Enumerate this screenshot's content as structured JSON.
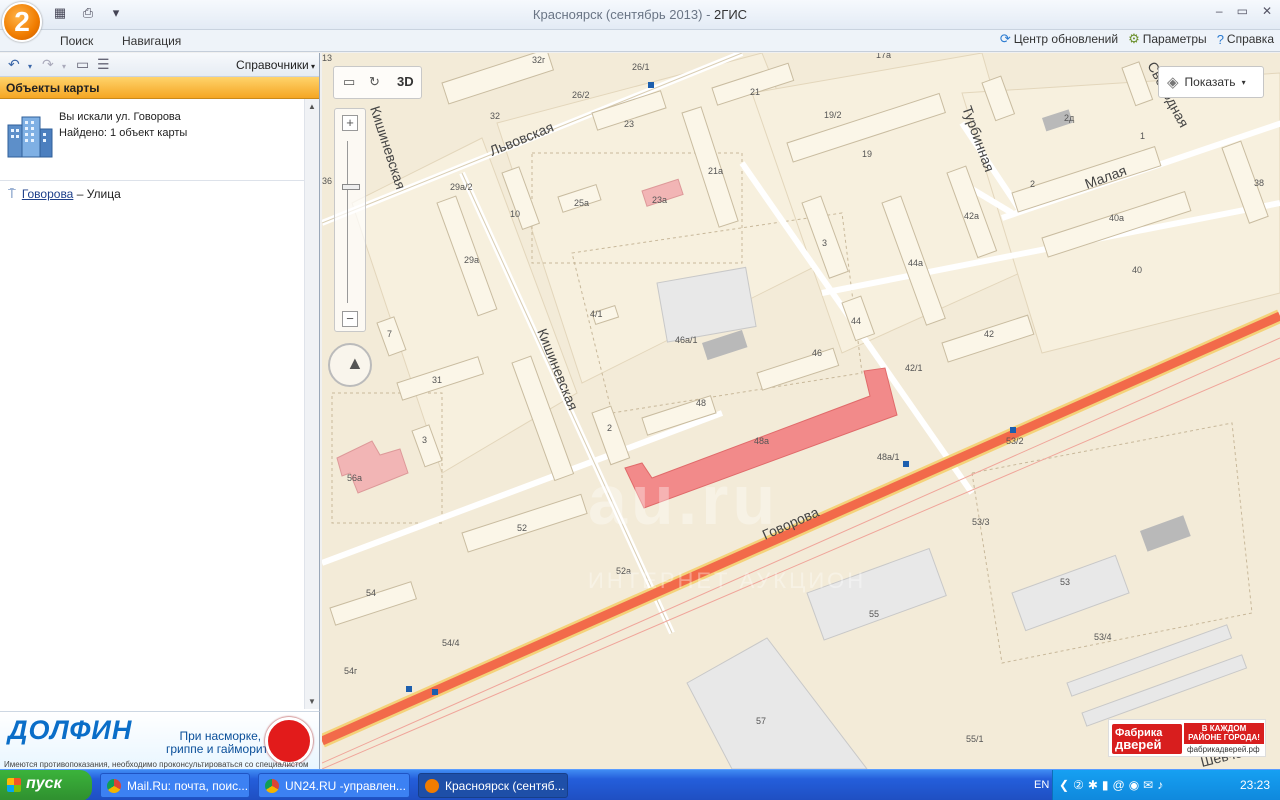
{
  "window": {
    "title_place": "Красноярск (сентябрь 2013)",
    "title_sep": " - ",
    "title_app": "2ГИС",
    "logo_text": "2"
  },
  "menu": {
    "items": [
      "Поиск",
      "Навигация"
    ],
    "right_links": [
      {
        "label": "Центр обновлений",
        "icon": "refresh-icon"
      },
      {
        "label": "Параметры",
        "icon": "gear-icon"
      },
      {
        "label": "Справка",
        "icon": "help-icon"
      }
    ]
  },
  "left_panel": {
    "catalog_label": "Справочники",
    "objects_header": "Объекты карты",
    "search_query_text": "Вы искали ул. Говорова",
    "search_found_text": "Найдено: 1 объект карты",
    "result": {
      "name": "Говорова",
      "suffix": " – Улица"
    }
  },
  "ad_left": {
    "brand": "ДОЛФИН",
    "slogan_line1": "При насморке,",
    "slogan_line2": "гриппе и гайморите",
    "disclaimer": "Имеются противопоказания, необходимо проконсультироваться со специалистом"
  },
  "map_controls": {
    "btn_3d": "3D",
    "show_button": "Показать"
  },
  "map": {
    "streets": [
      "Львовская",
      "Кишиневская",
      "Кишиневская",
      "Говорова",
      "Турбинная",
      "Малая",
      "Свободная",
      "Шевченко"
    ],
    "building_labels": [
      "32г",
      "26/1",
      "26/2",
      "32",
      "21",
      "23",
      "19/2",
      "17а",
      "19",
      "2д",
      "1",
      "36",
      "29а/2",
      "10",
      "25а",
      "23а",
      "21а",
      "2",
      "40а",
      "38",
      "42а",
      "3",
      "29а",
      "44а",
      "40",
      "7",
      "4/1",
      "46а/1",
      "44",
      "42",
      "31",
      "46",
      "42/1",
      "48",
      "3",
      "2",
      "48а",
      "48а/1",
      "53/2",
      "56а",
      "52",
      "53/3",
      "53",
      "52а",
      "54",
      "55",
      "54/4",
      "53/4",
      "54г",
      "57",
      "55/1",
      "13"
    ],
    "highlighted_building": "48а",
    "watermark": "au.ru",
    "watermark_sub": "ИНТЕРНЕТ АУКЦИОН"
  },
  "ad_right": {
    "brand_line1": "Фабрика",
    "brand_line2": "дверей",
    "slogan": "В КАЖДОМ РАЙОНЕ ГОРОДА!",
    "url": "фабрикадверей.рф"
  },
  "taskbar": {
    "start_label": "пуск",
    "tasks": [
      {
        "label": "Mail.Ru: почта, поис...",
        "active": false
      },
      {
        "label": "UN24.RU -управлен...",
        "active": false
      },
      {
        "label": "Красноярск (сентяб...",
        "active": true
      }
    ],
    "lang": "EN",
    "clock": "23:23"
  },
  "colors": {
    "main_road": "#f26a4a",
    "highlight": "#f28a8a",
    "block": "#f7f0de",
    "building": "#fbf6e8",
    "accent_orange": "#f5a623"
  }
}
